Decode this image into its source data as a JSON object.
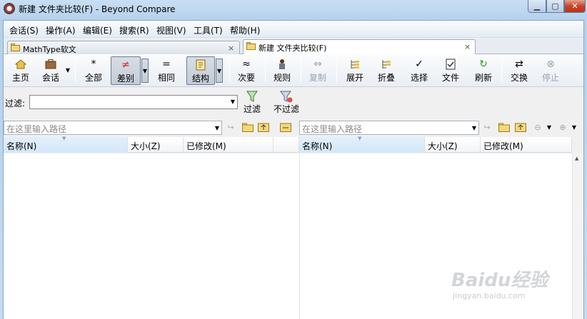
{
  "window": {
    "title": "新建 文件夹比较(F) - Beyond Compare"
  },
  "menu": [
    "会话(S)",
    "操作(A)",
    "编辑(E)",
    "搜索(R)",
    "视图(V)",
    "工具(T)",
    "帮助(H)"
  ],
  "tabs": [
    {
      "label": "MathType软文",
      "close": "×"
    },
    {
      "label": "新建 文件夹比较(F)",
      "close": "×"
    }
  ],
  "toolbar": {
    "home": "主页",
    "session": "会话",
    "all": "全部",
    "diff": "差别",
    "same": "相同",
    "structure": "结构",
    "minor": "次要",
    "rules": "规则",
    "copy": "复制",
    "expand": "展开",
    "collapse": "折叠",
    "select": "选择",
    "files": "文件",
    "refresh": "刷新",
    "swap": "交换",
    "stop": "停止"
  },
  "filter": {
    "label": "过滤:",
    "value": "",
    "apply": "过滤",
    "none": "不过滤"
  },
  "paths": {
    "left_placeholder": "在这里输入路径",
    "right_placeholder": "在这里输入路径"
  },
  "columns": {
    "left": [
      "名称(N)",
      "大小(Z)",
      "已修改(M)"
    ],
    "right": [
      "名称(N)",
      "大小(Z)",
      "已修改(M)"
    ]
  },
  "watermark": {
    "logo": "Baidu经验",
    "url": "jingyan.baidu.com"
  },
  "colors": {
    "accent": "#2a7ad1",
    "diff_red": "#d42a2a",
    "refresh_green": "#2e9a2e"
  }
}
